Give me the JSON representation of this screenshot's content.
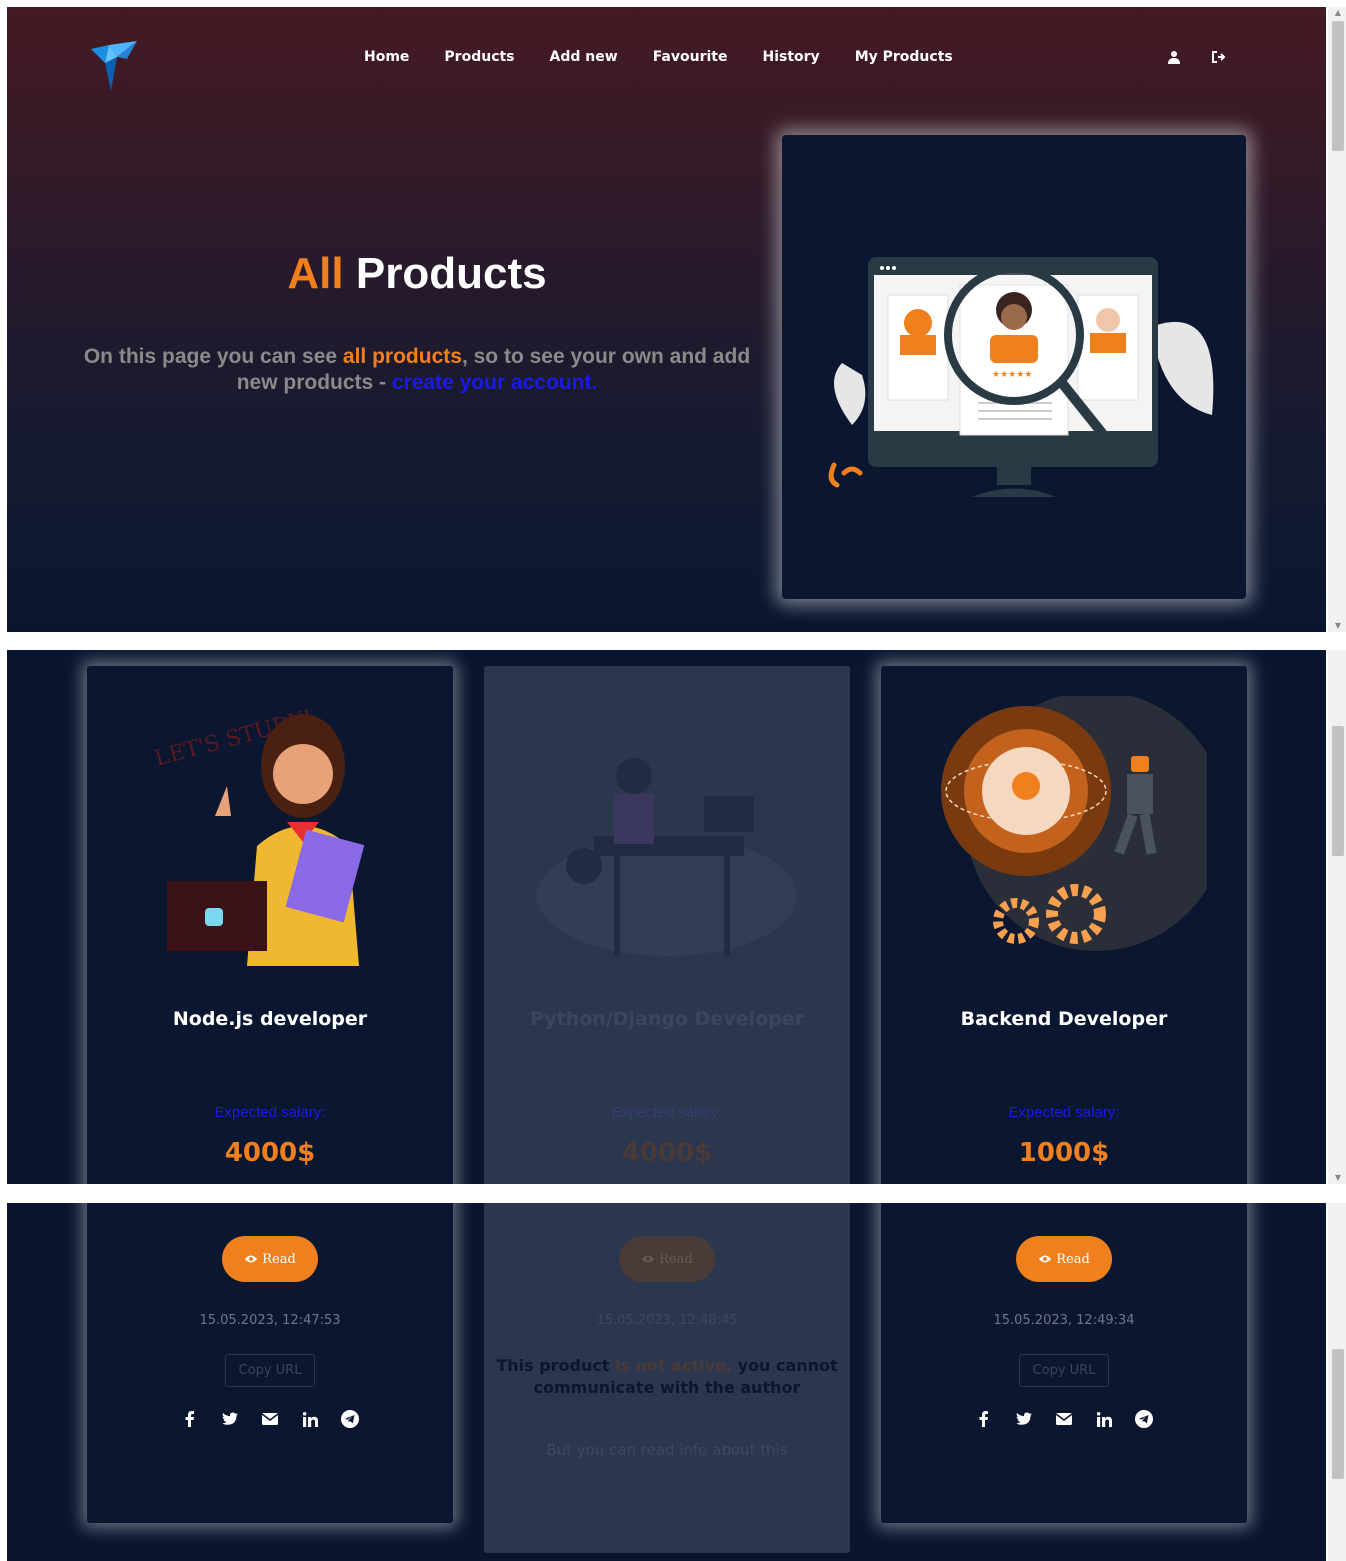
{
  "nav": {
    "items": [
      "Home",
      "Products",
      "Add new",
      "Favourite",
      "History",
      "My Products"
    ],
    "icons": [
      "user-icon",
      "logout-icon"
    ]
  },
  "hero": {
    "title_accent": "All",
    "title_rest": "Products",
    "text_1": "On this page you can see ",
    "text_highlight": "all products",
    "text_2": ", so to see your own and add new products - ",
    "text_link": "create your account."
  },
  "products": [
    {
      "title": "Node.js developer",
      "salary_label": "Expected salary:",
      "price": "4000$",
      "read_label": "Read",
      "date": "15.05.2023, 12:47:53",
      "copy_label": "Copy URL",
      "active": true
    },
    {
      "title": "Python/Django Developer",
      "salary_label": "Expected salary:",
      "price": "4000$",
      "read_label": "Read",
      "date": "15.05.2023, 12:48:45",
      "active": false,
      "msg_1": "This product ",
      "msg_red": "is not active,",
      "msg_2": " you cannot communicate with the author",
      "sub": "But you can read info about this"
    },
    {
      "title": "Backend Developer",
      "salary_label": "Expected salary:",
      "price": "1000$",
      "read_label": "Read",
      "date": "15.05.2023, 12:49:34",
      "copy_label": "Copy URL",
      "active": true
    }
  ],
  "social_icons": [
    "facebook-icon",
    "twitter-icon",
    "email-icon",
    "linkedin-icon",
    "telegram-icon"
  ],
  "colors": {
    "accent": "#f07f1e",
    "link": "#1a1ae6",
    "bg": "#0a1630"
  }
}
